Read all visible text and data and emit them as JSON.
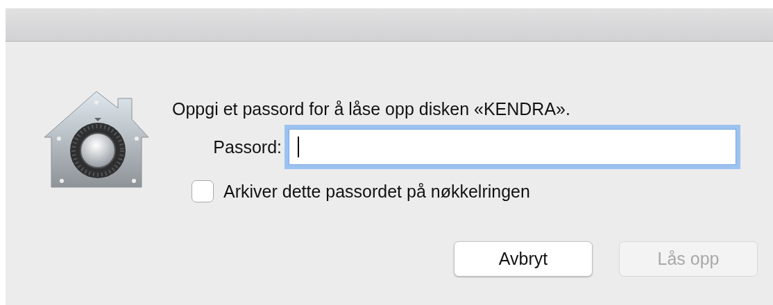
{
  "message": "Oppgi et passord for å låse opp disken «KENDRA».",
  "password_field": {
    "label": "Passord:",
    "focused": true
  },
  "remember_checkbox": {
    "label": "Arkiver dette passordet på nøkkelringen",
    "checked": false
  },
  "buttons": [
    {
      "label": "Avbryt",
      "disabled": false
    },
    {
      "label": "Lås opp",
      "disabled": true
    }
  ]
}
